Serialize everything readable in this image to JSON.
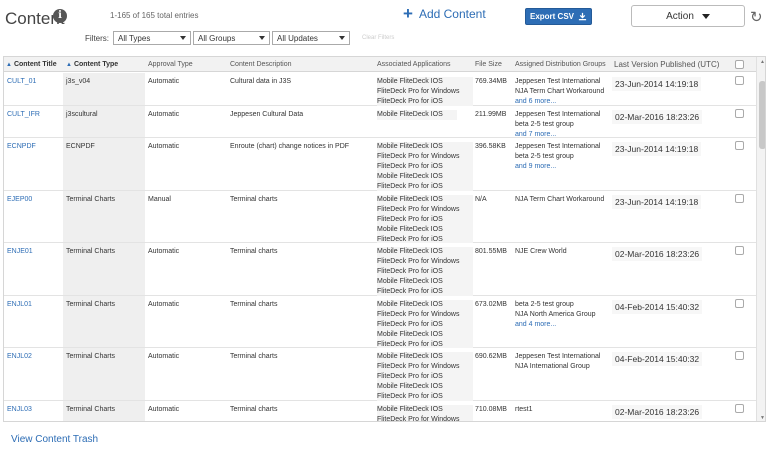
{
  "header": {
    "title": "Content",
    "info_icon": "i",
    "entries_count": "1-165 of 165 total entries",
    "add_content_label": "Add Content",
    "add_icon": "+",
    "export_label": "Export CSV",
    "action_label": "Action",
    "refresh_icon": "↻"
  },
  "filters": {
    "label": "Filters:",
    "types": "All Types",
    "groups": "All Groups",
    "updates": "All Updates",
    "clear_label": "Clear Filters"
  },
  "columns": {
    "title": "Content Title",
    "type": "Content Type",
    "approval": "Approval Type",
    "description": "Content Description",
    "apps": "Associated Applications",
    "size": "File Size",
    "groups": "Assigned Distribution Groups",
    "published": "Last Version Published (UTC)"
  },
  "rows": [
    {
      "title": "CULT_01",
      "type": "j3s_v04",
      "approval": "Automatic",
      "description": "Cultural data in J3S",
      "apps": [
        "Mobile FliteDeck IOS",
        "FliteDeck Pro for Windows",
        "FliteDeck Pro for iOS"
      ],
      "size": "769.34MB",
      "groups": [
        "Jeppesen Test International",
        "NJA Term Chart Workaround"
      ],
      "more": "and 6 more...",
      "published": "23-Jun-2014 14:19:18"
    },
    {
      "title": "CULT_IFR",
      "type": "j3scultural",
      "approval": "Automatic",
      "description": "Jeppesen Cultural Data",
      "apps": [
        "Mobile FliteDeck IOS"
      ],
      "size": "211.99MB",
      "groups": [
        "Jeppesen Test International",
        "beta 2-5 test group"
      ],
      "more": "and 7 more...",
      "published": "02-Mar-2016 18:23:26"
    },
    {
      "title": "ECNPDF",
      "type": "ECNPDF",
      "approval": "Automatic",
      "description": "Enroute (chart) change notices in PDF",
      "apps": [
        "Mobile FliteDeck IOS",
        "FliteDeck Pro for Windows",
        "FliteDeck Pro for iOS",
        "Mobile FliteDeck IOS",
        "FliteDeck Pro for iOS"
      ],
      "size": "396.58KB",
      "groups": [
        "Jeppesen Test International",
        "beta 2-5 test group"
      ],
      "more": "and 9 more...",
      "published": "23-Jun-2014 14:19:18"
    },
    {
      "title": "EJEP00",
      "type": "Terminal Charts",
      "approval": "Manual",
      "description": "Terminal charts",
      "apps": [
        "Mobile FliteDeck IOS",
        "FliteDeck Pro for Windows",
        "FliteDeck Pro for iOS",
        "Mobile FliteDeck IOS",
        "FliteDeck Pro for iOS"
      ],
      "size": "N/A",
      "groups": [
        "NJA Term Chart Workaround"
      ],
      "more": "",
      "published": "23-Jun-2014 14:19:18"
    },
    {
      "title": "ENJE01",
      "type": "Terminal Charts",
      "approval": "Automatic",
      "description": "Terminal charts",
      "apps": [
        "Mobile FliteDeck IOS",
        "FliteDeck Pro for Windows",
        "FliteDeck Pro for iOS",
        "Mobile FliteDeck IOS",
        "FliteDeck Pro for iOS"
      ],
      "size": "801.55MB",
      "groups": [
        "NJE Crew World"
      ],
      "more": "",
      "published": "02-Mar-2016 18:23:26"
    },
    {
      "title": "ENJL01",
      "type": "Terminal Charts",
      "approval": "Automatic",
      "description": "Terminal charts",
      "apps": [
        "Mobile FliteDeck IOS",
        "FliteDeck Pro for Windows",
        "FliteDeck Pro for iOS",
        "Mobile FliteDeck IOS",
        "FliteDeck Pro for iOS"
      ],
      "size": "673.02MB",
      "groups": [
        "beta 2-5 test group",
        "NJA North America Group"
      ],
      "more": "and 4 more...",
      "published": "04-Feb-2014 15:40:32"
    },
    {
      "title": "ENJL02",
      "type": "Terminal Charts",
      "approval": "Automatic",
      "description": "Terminal charts",
      "apps": [
        "Mobile FliteDeck IOS",
        "FliteDeck Pro for Windows",
        "FliteDeck Pro for iOS",
        "Mobile FliteDeck IOS",
        "FliteDeck Pro for iOS"
      ],
      "size": "690.62MB",
      "groups": [
        "Jeppesen Test International",
        "NJA International Group"
      ],
      "more": "",
      "published": "04-Feb-2014 15:40:32"
    },
    {
      "title": "ENJL03",
      "type": "Terminal Charts",
      "approval": "Automatic",
      "description": "Terminal charts",
      "apps": [
        "Mobile FliteDeck IOS",
        "FliteDeck Pro for Windows"
      ],
      "size": "710.08MB",
      "groups": [
        "rtest1"
      ],
      "more": "",
      "published": "02-Mar-2016 18:23:26"
    }
  ],
  "footer": {
    "trash_link": "View Content Trash"
  }
}
